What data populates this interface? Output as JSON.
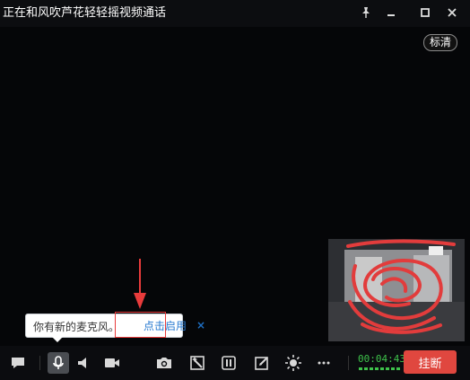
{
  "window": {
    "title": "正在和风吹芦花轻轻摇视频通话"
  },
  "video": {
    "quality_label": "标清"
  },
  "tooltip": {
    "message": "你有新的麦克风。",
    "link": "点击启用",
    "close": "×"
  },
  "toolbar": {
    "timer": "00:04:43",
    "hangup_label": "挂断"
  },
  "icons": {
    "pin": "pin-icon",
    "minimize": "minimize-icon",
    "maximize": "maximize-icon",
    "close": "close-icon",
    "chat": "chat-icon",
    "microphone": "microphone-icon",
    "speaker": "speaker-icon",
    "camera": "video-camera-icon",
    "screenshot": "screenshot-icon",
    "magic": "magic-wand-icon",
    "pause": "pause-icon",
    "edit": "edit-icon",
    "brightness": "brightness-icon",
    "more": "more-icon"
  },
  "colors": {
    "hangup": "#e0473f",
    "timer": "#3ec24b",
    "annotation": "#e83b3b"
  }
}
